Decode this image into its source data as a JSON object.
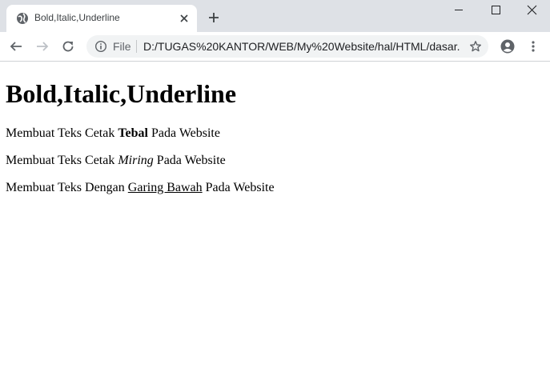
{
  "browser": {
    "tab": {
      "title": "Bold,Italic,Underline",
      "favicon": "globe-icon"
    },
    "omnibox": {
      "scheme_label": "File",
      "url": "D:/TUGAS%20KANTOR/WEB/My%20Website/hal/HTML/dasar..."
    },
    "icons": [
      "back-arrow-icon",
      "forward-arrow-icon",
      "reload-icon",
      "info-icon",
      "star-icon",
      "account-icon",
      "menu-icon",
      "minimize-icon",
      "maximize-icon",
      "close-window-icon",
      "new-tab-icon",
      "tab-close-icon"
    ]
  },
  "page": {
    "heading": "Bold,Italic,Underline",
    "lines": [
      {
        "before": "Membuat Teks Cetak ",
        "styled": "Tebal",
        "style": "bold",
        "after": " Pada Website"
      },
      {
        "before": "Membuat Teks Cetak ",
        "styled": "Miring",
        "style": "italic",
        "after": " Pada Website"
      },
      {
        "before": "Membuat Teks Dengan ",
        "styled": "Garing Bawah",
        "style": "underline",
        "after": " Pada Website"
      }
    ]
  },
  "colors": {
    "tabbar": "#dee1e6",
    "omnibox": "#f1f3f4",
    "icon": "#5f6368"
  }
}
